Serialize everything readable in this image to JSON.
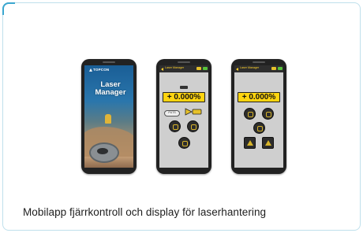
{
  "caption": "Mobilapp fjärrkontroll och display för laserhantering",
  "phones": {
    "splash": {
      "brand": "TOPCON",
      "app_title": "Laser Manager"
    },
    "remote": {
      "topbar": "Laser Manager",
      "readout": "+ 0.000%",
      "pill": "PUTS"
    },
    "display": {
      "topbar": "Laser Manager",
      "readout": "+ 0.000%"
    }
  },
  "colors": {
    "card_border": "#bfe0ec",
    "accent": "#3aa6cf",
    "readout_bg": "#ffd40f",
    "phone_body": "#222222"
  }
}
